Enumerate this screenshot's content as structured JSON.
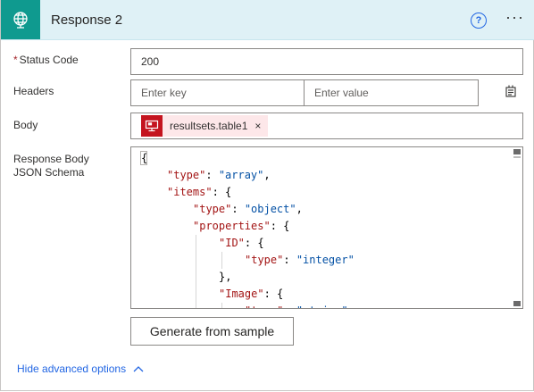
{
  "header": {
    "title": "Response 2",
    "help_glyph": "?",
    "more_glyph": "···",
    "accent_color": "#0f9a8f",
    "background_color": "#dff1f6"
  },
  "fields": {
    "status_code": {
      "required_mark": "*",
      "label": "Status Code",
      "value": "200"
    },
    "headers": {
      "label": "Headers",
      "key_placeholder": "Enter key",
      "value_placeholder": "Enter value",
      "toggle_icon": "text-mode-switch-icon"
    },
    "body": {
      "label": "Body",
      "token": {
        "text": "resultsets.table1",
        "remove_glyph": "×",
        "icon": "sql-server-icon",
        "color": "#c4141f"
      }
    },
    "schema": {
      "label": "Response Body JSON Schema",
      "lines": [
        [
          {
            "t": "p",
            "v": "{"
          }
        ],
        [
          {
            "t": "k",
            "v": "\"type\""
          },
          {
            "t": "p",
            "v": ": "
          },
          {
            "t": "s",
            "v": "\"array\""
          },
          {
            "t": "p",
            "v": ","
          }
        ],
        [
          {
            "t": "k",
            "v": "\"items\""
          },
          {
            "t": "p",
            "v": ": {"
          }
        ],
        [
          {
            "t": "k",
            "v": "\"type\""
          },
          {
            "t": "p",
            "v": ": "
          },
          {
            "t": "s",
            "v": "\"object\""
          },
          {
            "t": "p",
            "v": ","
          }
        ],
        [
          {
            "t": "k",
            "v": "\"properties\""
          },
          {
            "t": "p",
            "v": ": {"
          }
        ],
        [
          {
            "t": "k",
            "v": "\"ID\""
          },
          {
            "t": "p",
            "v": ": {"
          }
        ],
        [
          {
            "t": "k",
            "v": "\"type\""
          },
          {
            "t": "p",
            "v": ": "
          },
          {
            "t": "s",
            "v": "\"integer\""
          }
        ],
        [
          {
            "t": "p",
            "v": "},"
          }
        ],
        [
          {
            "t": "k",
            "v": "\"Image\""
          },
          {
            "t": "p",
            "v": ": {"
          }
        ],
        [
          {
            "t": "k",
            "v": "\"type\""
          },
          {
            "t": "p",
            "v": ": "
          },
          {
            "t": "s",
            "v": "\"string\""
          }
        ]
      ],
      "indent_levels": [
        0,
        1,
        1,
        2,
        2,
        3,
        4,
        3,
        3,
        4
      ]
    }
  },
  "generate_button": {
    "label": "Generate from sample"
  },
  "advanced": {
    "label": "Hide advanced options"
  }
}
